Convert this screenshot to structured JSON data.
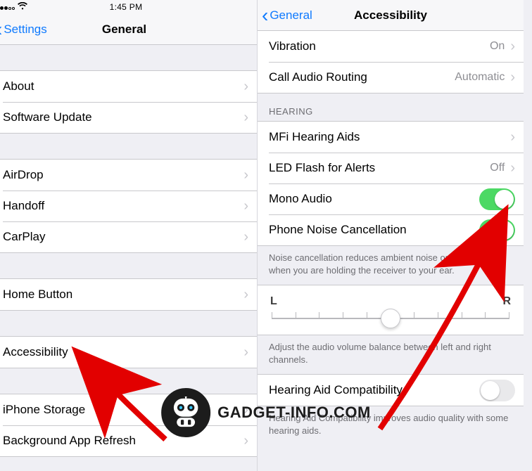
{
  "left_screen": {
    "status": {
      "time": "1:45 PM"
    },
    "nav": {
      "back_label": "Settings",
      "title": "General"
    },
    "groups": {
      "g1": {
        "about": "About",
        "software_update": "Software Update"
      },
      "g2": {
        "airdrop": "AirDrop",
        "handoff": "Handoff",
        "carplay": "CarPlay"
      },
      "g3": {
        "home_button": "Home Button"
      },
      "g4": {
        "accessibility": "Accessibility"
      },
      "g5": {
        "iphone_storage": "iPhone Storage",
        "bg_refresh": "Background App Refresh"
      }
    }
  },
  "right_screen": {
    "nav": {
      "back_label": "General",
      "title": "Accessibility"
    },
    "top_rows": {
      "vibration": {
        "label": "Vibration",
        "detail": "On"
      },
      "call_audio": {
        "label": "Call Audio Routing",
        "detail": "Automatic"
      }
    },
    "hearing": {
      "header": "HEARING",
      "mfi": "MFi Hearing Aids",
      "led_flash": {
        "label": "LED Flash for Alerts",
        "detail": "Off"
      },
      "mono_audio": {
        "label": "Mono Audio",
        "on": true
      },
      "noise_cancel": {
        "label": "Phone Noise Cancellation",
        "on": true
      },
      "noise_footer": "Noise cancellation reduces ambient noise on phone calls when you are holding the receiver to your ear."
    },
    "balance": {
      "left": "L",
      "right": "R",
      "footer": "Adjust the audio volume balance between left and right channels."
    },
    "hac": {
      "label": "Hearing Aid Compatibility",
      "on": false,
      "footer": "Hearing Aid Compatibility improves audio quality with some hearing aids."
    }
  },
  "watermark": {
    "text": "GADGET-INFO.COM"
  }
}
